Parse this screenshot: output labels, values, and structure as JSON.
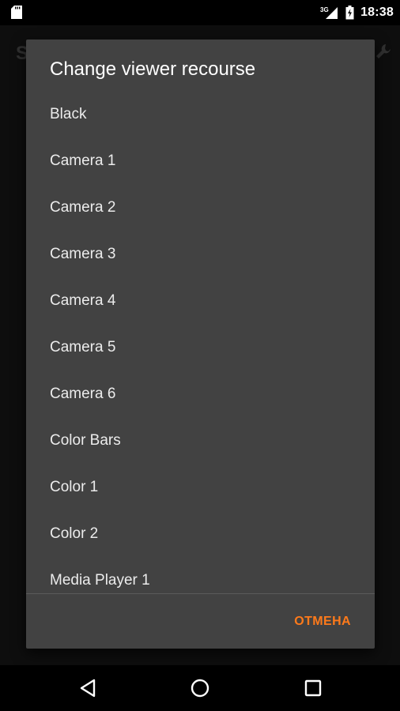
{
  "status_bar": {
    "network": "3G",
    "time": "18:38"
  },
  "background": {
    "title_partial": "S"
  },
  "dialog": {
    "title": "Change viewer recourse",
    "items": [
      "Black",
      "Camera 1",
      "Camera 2",
      "Camera 3",
      "Camera 4",
      "Camera 5",
      "Camera 6",
      "Color Bars",
      "Color 1",
      "Color 2",
      "Media Player 1"
    ],
    "cancel_label": "ОТМЕНА"
  },
  "colors": {
    "dialog_bg": "#424242",
    "accent": "#ff7a1a",
    "text": "#ececec"
  },
  "icons": {
    "status_left": "sd-card-icon",
    "signal": "signal-3g-icon",
    "battery": "battery-charging-icon",
    "nav_back": "back-triangle-icon",
    "nav_home": "home-circle-icon",
    "nav_recents": "recents-square-icon",
    "bg_action": "wrench-icon"
  }
}
